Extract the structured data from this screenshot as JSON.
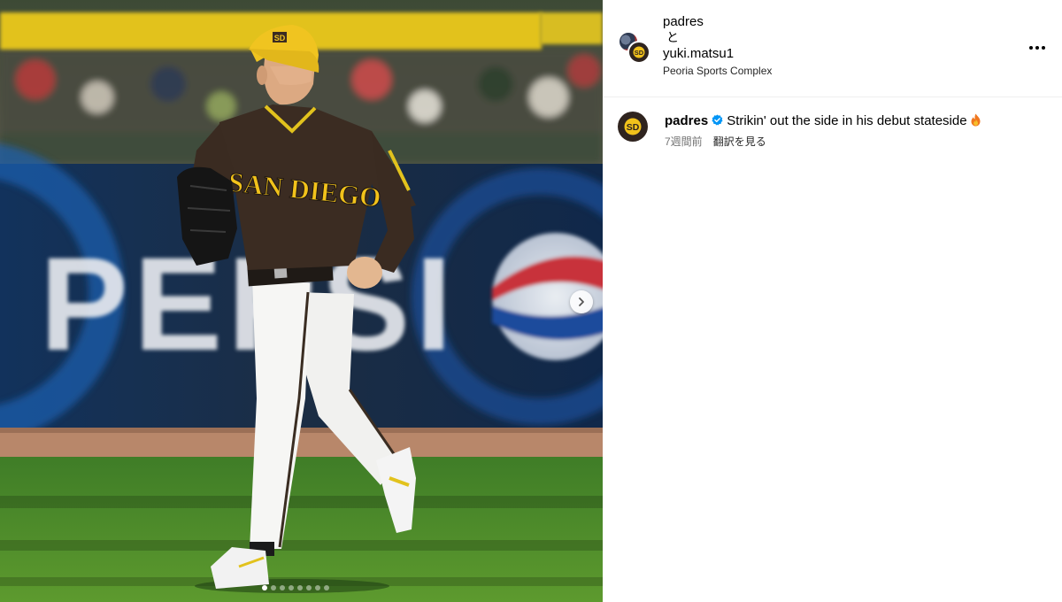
{
  "post": {
    "carousel": {
      "slide_count": 8,
      "active_index": 0
    },
    "header": {
      "username_1": "padres",
      "conjunction": "と",
      "username_2": "yuki.matsu1",
      "location": "Peoria Sports Complex"
    },
    "caption": {
      "username": "padres",
      "verified": true,
      "text": "Strikin' out the side in his debut stateside",
      "emoji_icon": "fire-emoji-icon",
      "time_ago": "7週間前",
      "see_translation": "翻訳を見る"
    },
    "photo": {
      "jersey_text": "SAN DIEGO",
      "cap_logo": "SD",
      "banner_text": "PEPSI"
    },
    "colors": {
      "brand_brown": "#2f241f",
      "brand_gold": "#f1c21b",
      "verified_blue": "#0095f6",
      "meta_gray": "#737373"
    }
  }
}
